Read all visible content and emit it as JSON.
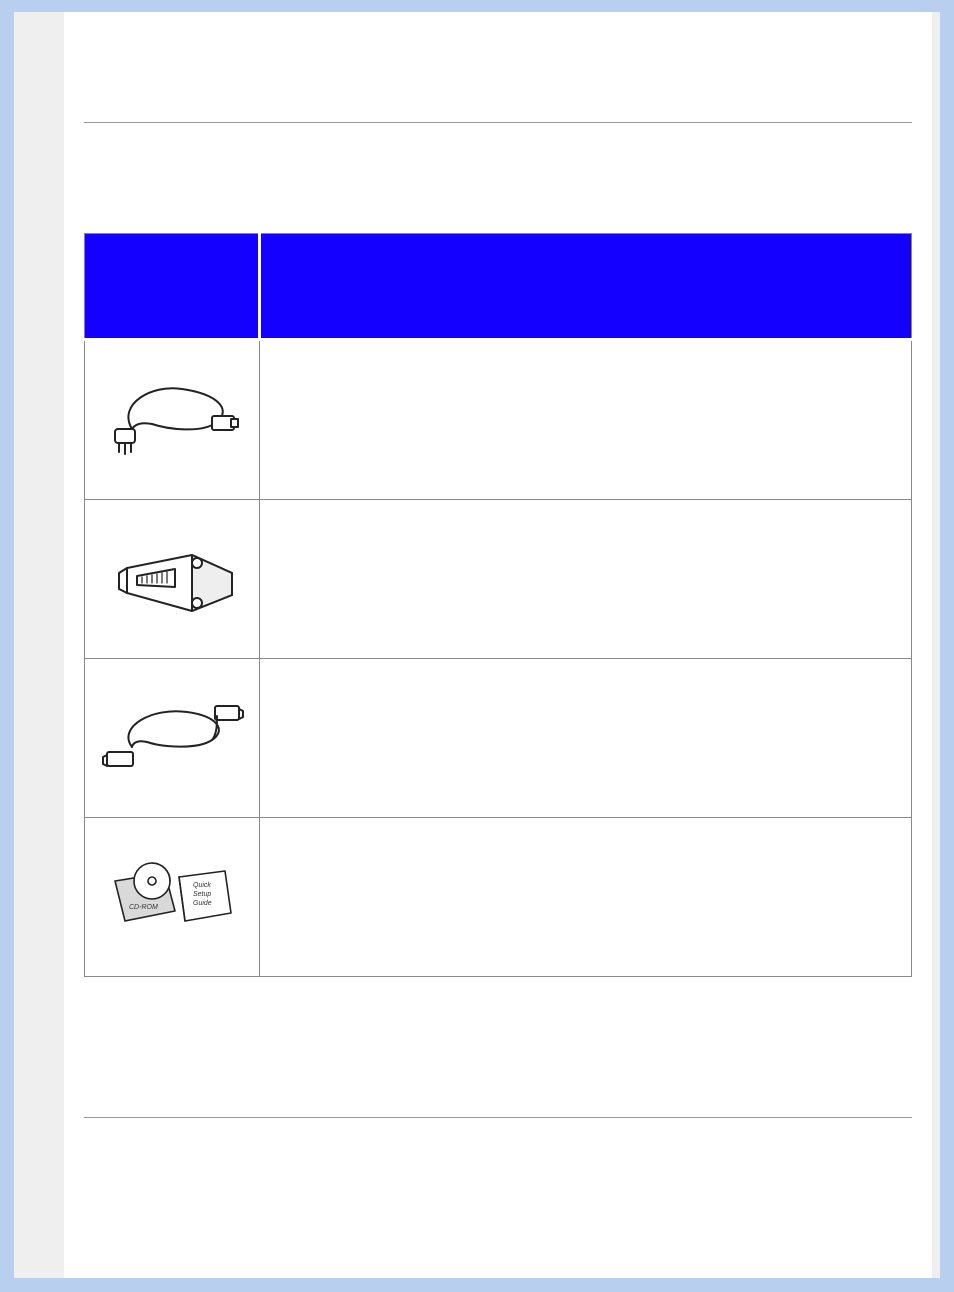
{
  "header": {
    "item_col": "",
    "desc_col": ""
  },
  "rows": [
    {
      "icon": "power-cord-icon",
      "desc": ""
    },
    {
      "icon": "vga-adapter-icon",
      "desc": ""
    },
    {
      "icon": "signal-cable-icon",
      "desc": ""
    },
    {
      "icon": "cdrom-guide-icon",
      "desc": ""
    }
  ]
}
